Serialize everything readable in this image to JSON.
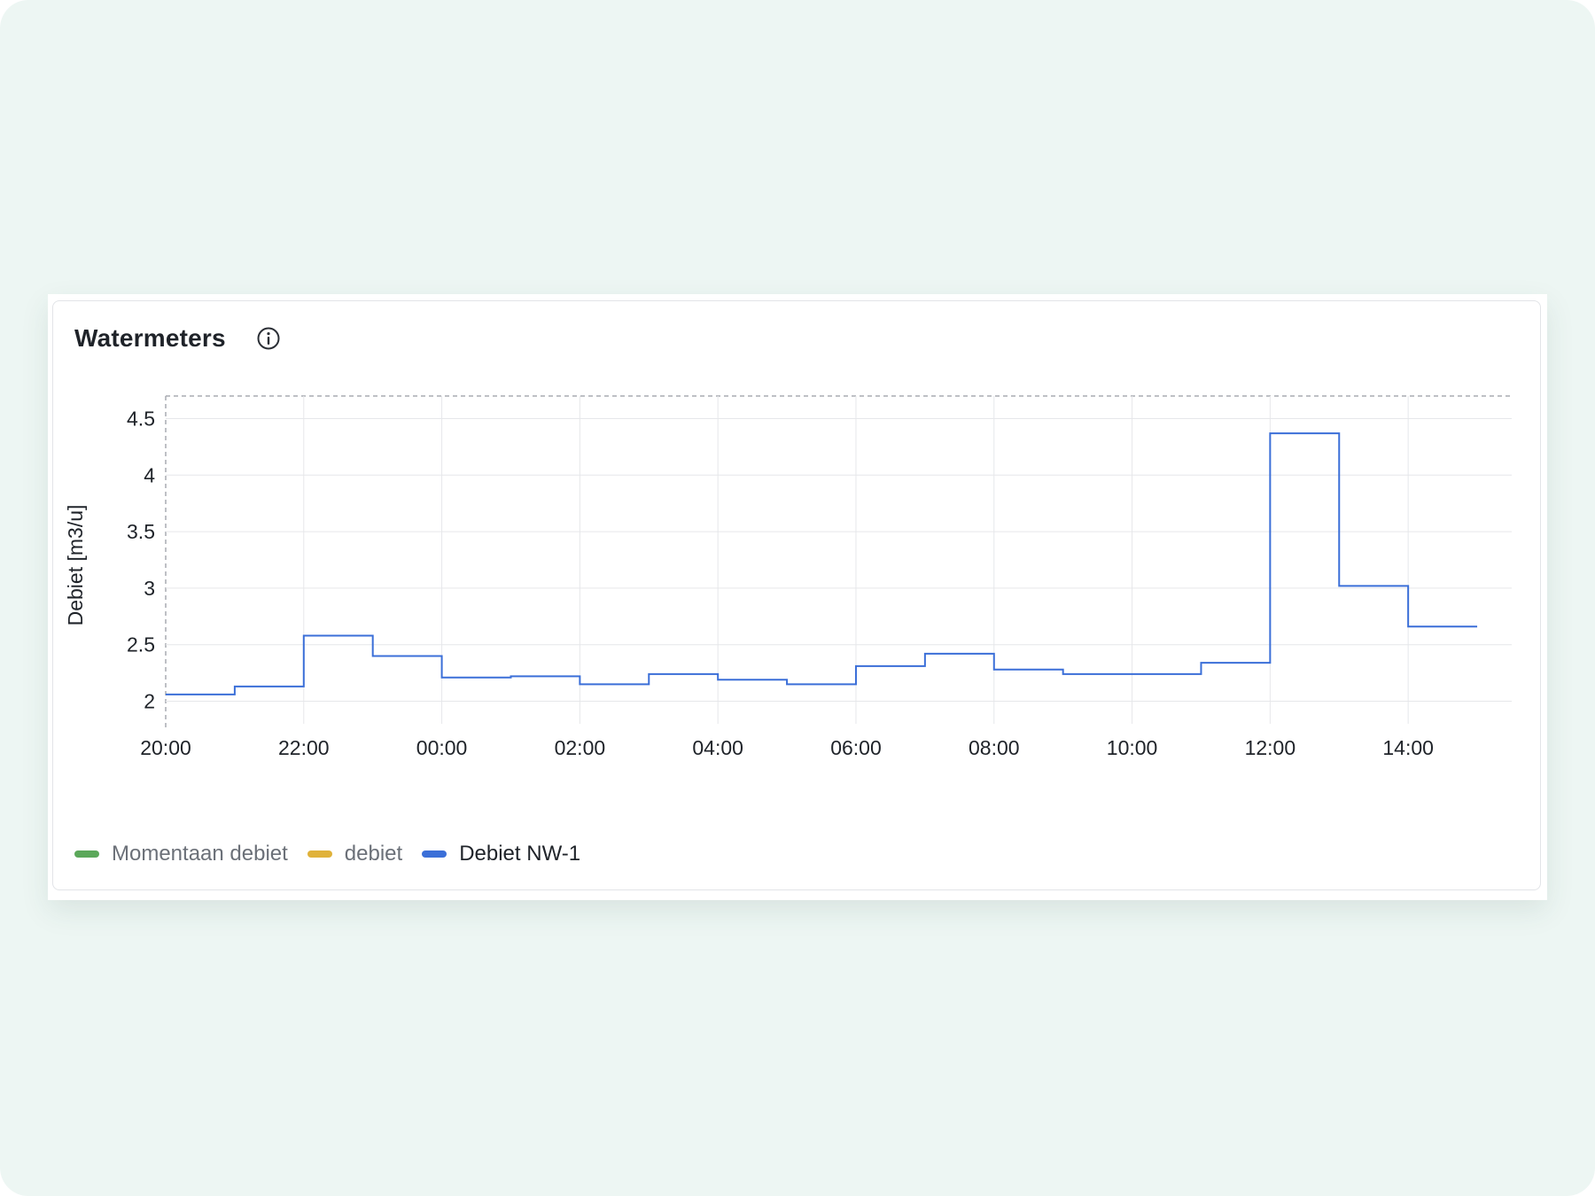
{
  "panel": {
    "title": "Watermeters",
    "info_icon": "info-circle-icon"
  },
  "colors": {
    "background": "#edf6f3",
    "series_blue": "#3b6fd8",
    "series_green": "#5ba85a",
    "series_yellow": "#e0b23a",
    "grid": "#e6e7ea",
    "axis_text": "#1f2329"
  },
  "legend": [
    {
      "name": "Momentaan debiet",
      "color": "#5ba85a",
      "active": false
    },
    {
      "name": "debiet",
      "color": "#e0b23a",
      "active": false
    },
    {
      "name": "Debiet NW-1",
      "color": "#3b6fd8",
      "active": true
    }
  ],
  "chart_data": {
    "type": "line",
    "interpolation": "step-after",
    "ylabel": "Debiet [m3/u]",
    "xlabel": "",
    "ylim": [
      1.8,
      4.7
    ],
    "yticks": [
      2,
      2.5,
      3,
      3.5,
      4,
      4.5
    ],
    "ytick_labels": [
      "2",
      "2.5",
      "3",
      "3.5",
      "4",
      "4.5"
    ],
    "xlim": [
      "20:00",
      "15:30"
    ],
    "xticks": [
      "20:00",
      "22:00",
      "00:00",
      "02:00",
      "04:00",
      "06:00",
      "08:00",
      "10:00",
      "12:00",
      "14:00"
    ],
    "grid": true,
    "legend_position": "bottom-left",
    "series": [
      {
        "name": "Debiet NW-1",
        "color": "#3b6fd8",
        "x": [
          "20:00",
          "21:00",
          "22:00",
          "23:00",
          "00:00",
          "01:00",
          "02:00",
          "03:00",
          "04:00",
          "05:00",
          "06:00",
          "07:00",
          "08:00",
          "09:00",
          "10:00",
          "11:00",
          "12:00",
          "13:00",
          "14:00",
          "15:00"
        ],
        "values": [
          2.06,
          2.13,
          2.58,
          2.4,
          2.21,
          2.22,
          2.15,
          2.24,
          2.19,
          2.15,
          2.31,
          2.42,
          2.28,
          2.24,
          2.24,
          2.34,
          4.37,
          3.02,
          2.66,
          2.66
        ]
      }
    ]
  }
}
